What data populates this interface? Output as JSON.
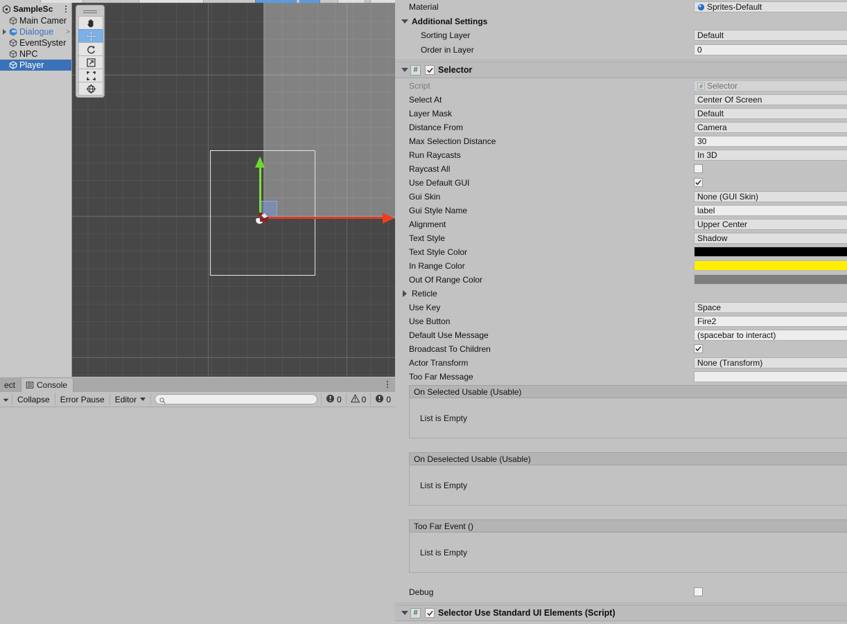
{
  "hierarchy": {
    "scene_name": "SampleSc",
    "scene_icon": "unity-scene-icon",
    "menu_icon": "kebab-menu-icon",
    "items": [
      {
        "label": "Main Camer",
        "icon": "gameobject-cube-icon",
        "expandable": false,
        "selected": false,
        "prefab": false
      },
      {
        "label": "Dialogue",
        "icon": "prefab-cube-icon",
        "expandable": true,
        "selected": false,
        "prefab": true,
        "overflow": ">"
      },
      {
        "label": "EventSyster",
        "icon": "gameobject-cube-icon",
        "expandable": false,
        "selected": false,
        "prefab": false
      },
      {
        "label": "NPC",
        "icon": "gameobject-cube-icon",
        "expandable": false,
        "selected": false,
        "prefab": false
      },
      {
        "label": "Player",
        "icon": "gameobject-cube-icon",
        "expandable": false,
        "selected": true,
        "prefab": false
      }
    ]
  },
  "scene_view": {
    "tools": [
      {
        "name": "hand-tool",
        "icon": "hand-icon",
        "active": false
      },
      {
        "name": "move-tool",
        "icon": "move-arrows-icon",
        "active": true
      },
      {
        "name": "rotate-tool",
        "icon": "rotate-icon",
        "active": false
      },
      {
        "name": "scale-tool",
        "icon": "scale-icon",
        "active": false
      },
      {
        "name": "rect-tool",
        "icon": "rect-transform-icon",
        "active": false
      },
      {
        "name": "transform-tool",
        "icon": "transform-globe-icon",
        "active": false
      }
    ],
    "gizmo": {
      "x_axis_color": "#e03b22",
      "y_axis_color": "#7ee039",
      "plane_color": "#7896d2"
    },
    "cursor": "arrow-cursor"
  },
  "console": {
    "tabs": [
      {
        "label": "ect",
        "icon": "project-icon",
        "active": false
      },
      {
        "label": "Console",
        "icon": "console-icon",
        "active": true
      }
    ],
    "menu_icon": "kebab-menu-icon",
    "toolbar": {
      "clear_dropdown_icon": "chevron-down-icon",
      "collapse_label": "Collapse",
      "error_pause_label": "Error Pause",
      "editor_label": "Editor",
      "editor_caret_icon": "chevron-down-icon",
      "search_placeholder": "",
      "search_value": "",
      "search_icon": "search-icon",
      "counters": [
        {
          "icon": "error-icon",
          "value": "0"
        },
        {
          "icon": "warning-icon",
          "value": "0"
        },
        {
          "icon": "info-icon",
          "value": "0"
        }
      ]
    }
  },
  "inspector": {
    "sprite_renderer_tail": {
      "material_label": "Material",
      "material_value": "Sprites-Default",
      "material_icon": "material-sphere-icon",
      "additional_settings_label": "Additional Settings",
      "sorting_layer_label": "Sorting Layer",
      "sorting_layer_value": "Default",
      "order_in_layer_label": "Order in Layer",
      "order_in_layer_value": "0"
    },
    "selector": {
      "title": "Selector",
      "badge": "#",
      "enabled": true,
      "fields": [
        {
          "label": "Script",
          "value": "Selector",
          "type": "object-readonly",
          "icon": "script-icon"
        },
        {
          "label": "Select At",
          "value": "Center Of Screen",
          "type": "popup"
        },
        {
          "label": "Layer Mask",
          "value": "Default",
          "type": "popup"
        },
        {
          "label": "Distance From",
          "value": "Camera",
          "type": "popup"
        },
        {
          "label": "Max Selection Distance",
          "value": "30",
          "type": "text"
        },
        {
          "label": "Run Raycasts",
          "value": "In 3D",
          "type": "popup"
        },
        {
          "label": "Raycast All",
          "value": false,
          "type": "checkbox"
        },
        {
          "label": "Use Default GUI",
          "value": true,
          "type": "checkbox"
        },
        {
          "label": "Gui Skin",
          "value": "None (GUI Skin)",
          "type": "object"
        },
        {
          "label": "Gui Style Name",
          "value": "label",
          "type": "text"
        },
        {
          "label": "Alignment",
          "value": "Upper Center",
          "type": "popup"
        },
        {
          "label": "Text Style",
          "value": "Shadow",
          "type": "popup"
        },
        {
          "label": "Text Style Color",
          "value": "#000000",
          "type": "color"
        },
        {
          "label": "In Range Color",
          "value": "#FFEE00",
          "type": "color"
        },
        {
          "label": "Out Of Range Color",
          "value": "#7E7E7E",
          "type": "color"
        },
        {
          "label": "Reticle",
          "value": "",
          "type": "foldout-collapsed"
        },
        {
          "label": "Use Key",
          "value": "Space",
          "type": "popup"
        },
        {
          "label": "Use Button",
          "value": "Fire2",
          "type": "text"
        },
        {
          "label": "Default Use Message",
          "value": "(spacebar to interact)",
          "type": "text"
        },
        {
          "label": "Broadcast To Children",
          "value": true,
          "type": "checkbox"
        },
        {
          "label": "Actor Transform",
          "value": "None (Transform)",
          "type": "object"
        },
        {
          "label": "Too Far Message",
          "value": "",
          "type": "text"
        }
      ],
      "events": [
        {
          "header": "On Selected Usable (Usable)",
          "body": "List is Empty"
        },
        {
          "header": "On Deselected Usable (Usable)",
          "body": "List is Empty"
        },
        {
          "header": "Too Far Event ()",
          "body": "List is Empty"
        }
      ],
      "debug_label": "Debug",
      "debug_value": false
    },
    "next_component": {
      "title": "Selector Use Standard UI Elements (Script)",
      "badge": "#",
      "enabled": true
    }
  }
}
